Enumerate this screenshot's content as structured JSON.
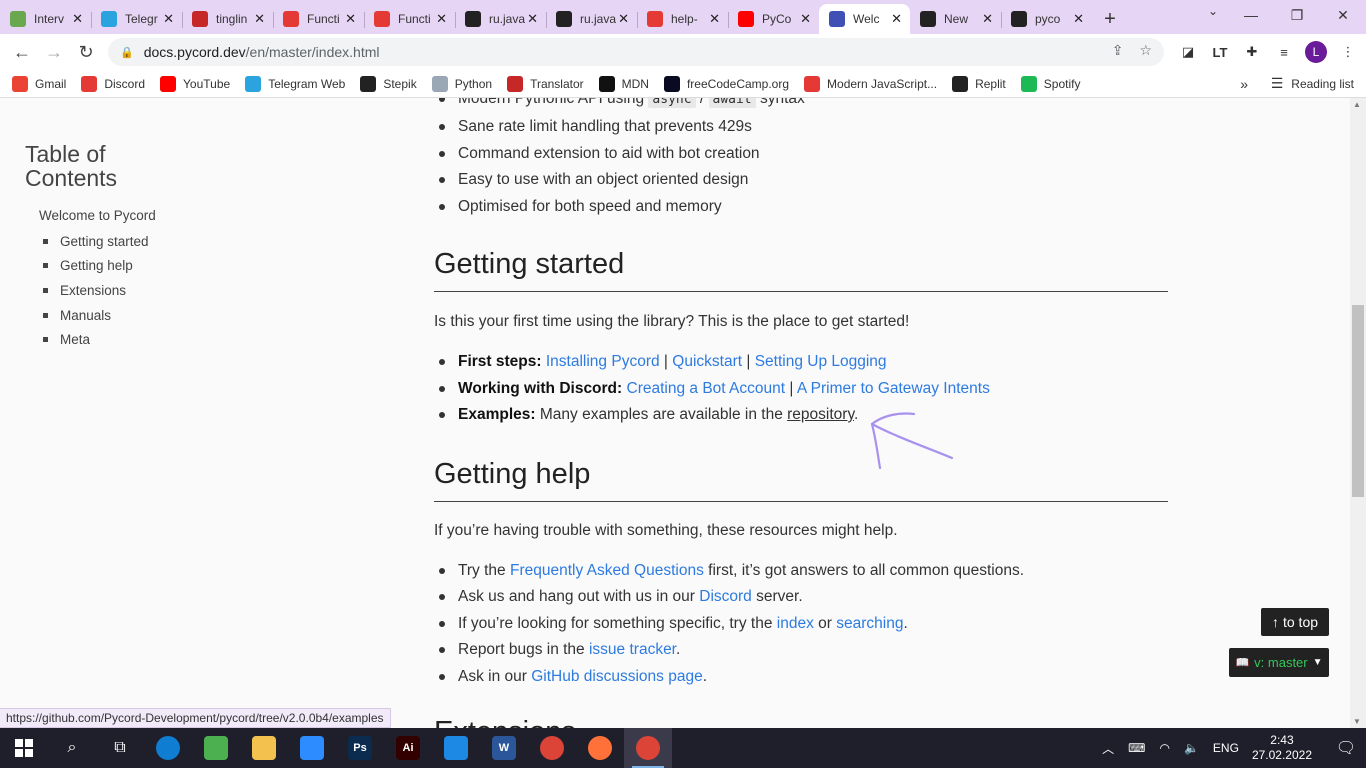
{
  "browser": {
    "tabs": [
      {
        "title": "Interv",
        "icon": "square-green-icon",
        "color": "#6aa84f"
      },
      {
        "title": "Telegr",
        "icon": "telegram-icon",
        "color": "#2aa3df"
      },
      {
        "title": "tinglin",
        "icon": "translator-icon",
        "color": "#c62828"
      },
      {
        "title": "Functi",
        "icon": "modern-js-icon",
        "color": "#e53935"
      },
      {
        "title": "Functi",
        "icon": "modern-js-icon",
        "color": "#e53935"
      },
      {
        "title": "ru.java",
        "icon": "github-icon",
        "color": "#222222"
      },
      {
        "title": "ru.java",
        "icon": "github-icon",
        "color": "#222222"
      },
      {
        "title": "help-",
        "icon": "discord-badge-icon",
        "color": "#e53935"
      },
      {
        "title": "PyCo",
        "icon": "youtube-icon",
        "color": "#ff0000"
      },
      {
        "title": "Welc",
        "icon": "pycord-icon",
        "color": "#3f51b5",
        "active": true
      },
      {
        "title": "New",
        "icon": "github-icon",
        "color": "#222222"
      },
      {
        "title": "pyco",
        "icon": "github-icon",
        "color": "#222222"
      }
    ],
    "new_tab": "+",
    "url_host": "docs.pycord.dev",
    "url_path": "/en/master/index.html",
    "profile_initial": "L",
    "bookmarks": [
      {
        "label": "Gmail",
        "icon": "gmail-icon",
        "color": "#ea4335"
      },
      {
        "label": "Discord",
        "icon": "discord-icon",
        "color": "#e53935"
      },
      {
        "label": "YouTube",
        "icon": "youtube-icon",
        "color": "#ff0000"
      },
      {
        "label": "Telegram Web",
        "icon": "telegram-icon",
        "color": "#2aa3df"
      },
      {
        "label": "Stepik",
        "icon": "stepik-icon",
        "color": "#222222"
      },
      {
        "label": "Python",
        "icon": "book-icon",
        "color": "#9aa7b5"
      },
      {
        "label": "Translator",
        "icon": "translator-icon",
        "color": "#c62828"
      },
      {
        "label": "MDN",
        "icon": "mdn-icon",
        "color": "#111111"
      },
      {
        "label": "freeCodeCamp.org",
        "icon": "freecodecamp-icon",
        "color": "#0a0a23"
      },
      {
        "label": "Modern JavaScript...",
        "icon": "modern-js-icon",
        "color": "#e53935"
      },
      {
        "label": "Replit",
        "icon": "replit-icon",
        "color": "#222222"
      },
      {
        "label": "Spotify",
        "icon": "spotify-icon",
        "color": "#1db954"
      }
    ],
    "bookmarks_more": "»",
    "reading_list": "Reading list",
    "status_url": "https://github.com/Pycord-Development/pycord/tree/v2.0.0b4/examples"
  },
  "toc": {
    "title_line1": "Table of",
    "title_line2": "Contents",
    "root": "Welcome to Pycord",
    "items": [
      "Getting started",
      "Getting help",
      "Extensions",
      "Manuals",
      "Meta"
    ]
  },
  "content": {
    "features_partial_prefix": "Modern Pythonic API using",
    "features_partial_code1": "async",
    "features_partial_sep": "/",
    "features_partial_code2": "await",
    "features_partial_suffix": "syntax",
    "features": [
      "Sane rate limit handling that prevents 429s",
      "Command extension to aid with bot creation",
      "Easy to use with an object oriented design",
      "Optimised for both speed and memory"
    ],
    "getting_started": {
      "heading": "Getting started",
      "intro": "Is this your first time using the library? This is the place to get started!",
      "first_steps_label": "First steps:",
      "first_steps_links": [
        "Installing Pycord",
        "Quickstart",
        "Setting Up Logging"
      ],
      "working_label": "Working with Discord:",
      "working_links": [
        "Creating a Bot Account",
        "A Primer to Gateway Intents"
      ],
      "separator": "|",
      "examples_label": "Examples:",
      "examples_text": "Many examples are available in the",
      "examples_link": "repository",
      "examples_end": "."
    },
    "getting_help": {
      "heading": "Getting help",
      "intro": "If you’re having trouble with something, these resources might help.",
      "b1_pre": "Try the",
      "b1_link": "Frequently Asked Questions",
      "b1_post": "first, it’s got answers to all common questions.",
      "b2_pre": "Ask us and hang out with us in our",
      "b2_link": "Discord",
      "b2_post": "server.",
      "b3_pre": "If you’re looking for something specific, try the",
      "b3_link1": "index",
      "b3_mid": "or",
      "b3_link2": "searching",
      "b3_post": ".",
      "b4_pre": "Report bugs in the",
      "b4_link": "issue tracker",
      "b4_post": ".",
      "b5_pre": "Ask in our",
      "b5_link": "GitHub discussions page",
      "b5_post": "."
    },
    "next_heading_partial": "Extensions"
  },
  "widgets": {
    "to_top": "to top",
    "version": "v: master"
  },
  "taskbar": {
    "apps": [
      {
        "name": "edge",
        "icon": "edge-icon",
        "color": "#0f7dd1"
      },
      {
        "name": "utorrent",
        "icon": "utorrent-icon",
        "color": "#4caf50"
      },
      {
        "name": "explorer",
        "icon": "folder-icon",
        "color": "#f2c14e"
      },
      {
        "name": "zoom",
        "icon": "zoom-icon",
        "color": "#2d8cff"
      },
      {
        "name": "photoshop",
        "icon": "photoshop-icon",
        "color": "#0b2b4f",
        "text": "Ps"
      },
      {
        "name": "illustrator",
        "icon": "illustrator-icon",
        "color": "#330000",
        "text": "Ai"
      },
      {
        "name": "vscode",
        "icon": "vscode-icon",
        "color": "#1e88e5"
      },
      {
        "name": "word",
        "icon": "word-icon",
        "color": "#2b579a",
        "text": "W"
      },
      {
        "name": "chrome",
        "icon": "chrome-icon",
        "color": "#db4437"
      },
      {
        "name": "firefox",
        "icon": "firefox-icon",
        "color": "#ff7139"
      },
      {
        "name": "chrome-profile",
        "icon": "chrome-profile-icon",
        "color": "#db4437",
        "active": true
      }
    ],
    "language": "ENG",
    "time": "2:43",
    "date": "27.02.2022"
  }
}
